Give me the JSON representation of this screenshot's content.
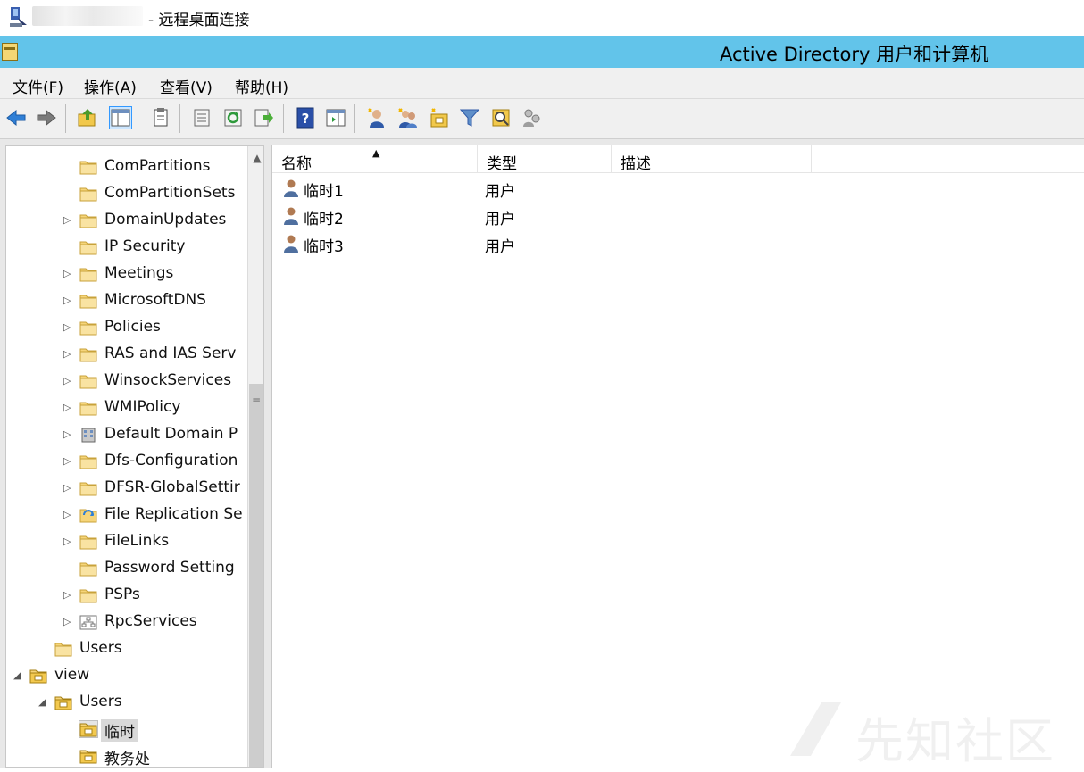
{
  "rdp": {
    "title": "- 远程桌面连接"
  },
  "app": {
    "title": "Active Directory 用户和计算机"
  },
  "menu": [
    {
      "label": "文件(F)"
    },
    {
      "label": "操作(A)"
    },
    {
      "label": "查看(V)"
    },
    {
      "label": "帮助(H)"
    }
  ],
  "toolbar": {
    "icons": [
      "back-icon",
      "forward-icon",
      "up-folder-icon",
      "show-tree-icon",
      "properties-icon",
      "export-list-icon",
      "refresh-icon",
      "export-icon",
      "help-icon",
      "show-action-pane-icon",
      "new-user-icon",
      "new-group-icon",
      "new-ou-icon",
      "filter-icon",
      "find-icon",
      "delegate-icon"
    ]
  },
  "tree": {
    "items": [
      {
        "label": "ComPartitions",
        "icon": "folder",
        "expander": ""
      },
      {
        "label": "ComPartitionSets",
        "icon": "folder",
        "expander": ""
      },
      {
        "label": "DomainUpdates",
        "icon": "folder",
        "expander": "▷"
      },
      {
        "label": "IP Security",
        "icon": "folder",
        "expander": ""
      },
      {
        "label": "Meetings",
        "icon": "folder",
        "expander": "▷"
      },
      {
        "label": "MicrosoftDNS",
        "icon": "folder",
        "expander": "▷"
      },
      {
        "label": "Policies",
        "icon": "folder",
        "expander": "▷"
      },
      {
        "label": "RAS and IAS Serv",
        "icon": "folder",
        "expander": "▷"
      },
      {
        "label": "WinsockServices",
        "icon": "folder",
        "expander": "▷"
      },
      {
        "label": "WMIPolicy",
        "icon": "folder",
        "expander": "▷"
      },
      {
        "label": "Default Domain P",
        "icon": "building",
        "expander": "▷"
      },
      {
        "label": "Dfs-Configuration",
        "icon": "folder",
        "expander": "▷"
      },
      {
        "label": "DFSR-GlobalSettir",
        "icon": "folder",
        "expander": "▷"
      },
      {
        "label": "File Replication Se",
        "icon": "replication",
        "expander": "▷"
      },
      {
        "label": "FileLinks",
        "icon": "folder",
        "expander": "▷"
      },
      {
        "label": "Password Setting",
        "icon": "folder",
        "expander": ""
      },
      {
        "label": "PSPs",
        "icon": "folder",
        "expander": "▷"
      },
      {
        "label": "RpcServices",
        "icon": "rpc",
        "expander": "▷"
      },
      {
        "label": "Users",
        "icon": "folder",
        "expander": ""
      },
      {
        "label": "view",
        "icon": "ou",
        "expander": "◢"
      },
      {
        "label": "Users",
        "icon": "ou",
        "expander": "◢"
      },
      {
        "label": "临时",
        "icon": "ou",
        "expander": ""
      },
      {
        "label": "教务处",
        "icon": "ou",
        "expander": ""
      }
    ]
  },
  "list": {
    "columns": [
      "名称",
      "类型",
      "描述"
    ],
    "sort_column": "名称",
    "rows": [
      {
        "name": "临时1",
        "type": "用户"
      },
      {
        "name": "临时2",
        "type": "用户"
      },
      {
        "name": "临时3",
        "type": "用户"
      }
    ]
  },
  "watermark": {
    "text": "先知社区"
  }
}
